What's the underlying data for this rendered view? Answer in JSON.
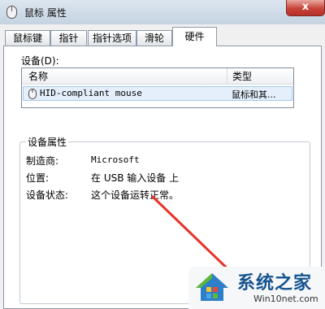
{
  "window": {
    "title": "鼠标 属性",
    "close_symbol": "x"
  },
  "tabs": [
    {
      "label": "鼠标键"
    },
    {
      "label": "指针"
    },
    {
      "label": "指针选项"
    },
    {
      "label": "滑轮"
    },
    {
      "label": "硬件",
      "active": true
    }
  ],
  "devices": {
    "label": "设备(D):",
    "columns": [
      "名称",
      "类型"
    ],
    "rows": [
      {
        "name": "HID-compliant mouse",
        "type": "鼠标和其..."
      }
    ]
  },
  "properties": {
    "title": "设备属性",
    "items": [
      {
        "label": "制造商:",
        "value": "Microsoft"
      },
      {
        "label": "位置:",
        "value": "在 USB 输入设备 上"
      },
      {
        "label": "设备状态:",
        "value": "这个设备运转正常。"
      }
    ]
  },
  "watermark": {
    "main": "系统之家",
    "sub": "Win10net.com"
  },
  "colors": {
    "arrow": "#e8322b",
    "title_bar": "#c4d2e1",
    "watermark_text": "#14538f"
  }
}
